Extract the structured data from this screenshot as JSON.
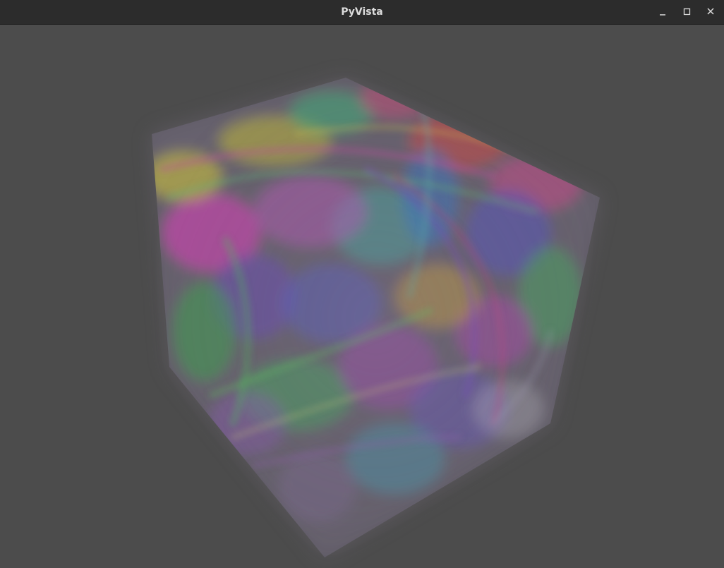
{
  "window": {
    "title": "PyVista",
    "controls": {
      "minimize_icon": "minimize-icon",
      "maximize_icon": "maximize-icon",
      "close_icon": "close-icon"
    }
  },
  "colors": {
    "titlebar": "#2c2c2c",
    "title_text": "#dcdcdc",
    "viewport_background": "#4c4c4c"
  }
}
